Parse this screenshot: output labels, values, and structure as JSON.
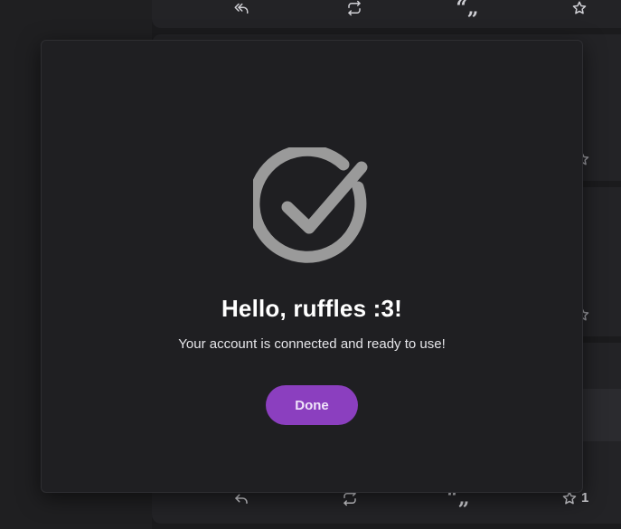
{
  "timeline": {
    "top_post": {
      "actions": {
        "reply_icon": "reply-all-icon",
        "boost_icon": "repeat-icon",
        "quote_label": "“„",
        "favourite_icon": "star-icon"
      }
    },
    "bottom_post": {
      "actions": {
        "reply_icon": "reply-icon",
        "boost_icon": "repeat-icon",
        "quote_label": "“„",
        "favourite_icon": "star-icon",
        "favourite_count": "1"
      }
    }
  },
  "modal": {
    "icon": "check-circle-icon",
    "title": "Hello, ruffles :3!",
    "message": "Your account is connected and ready to use!",
    "done_label": "Done"
  },
  "colors": {
    "accent": "#8b3fbf",
    "check": "#9a9a9a",
    "modal_bg": "#1f1f22"
  }
}
